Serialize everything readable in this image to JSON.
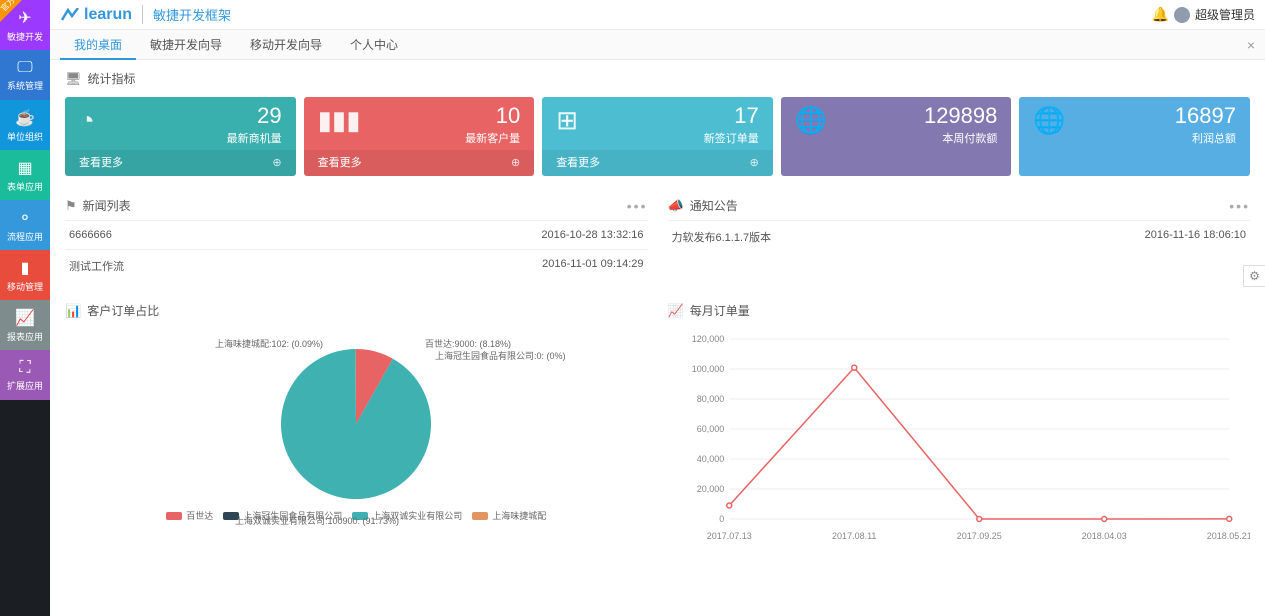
{
  "corner_tag": "官方",
  "logo": {
    "text": "learun",
    "sub": "敏捷开发框架"
  },
  "user": {
    "name": "超级管理员"
  },
  "sidebar": {
    "items": [
      {
        "label": "敏捷开发"
      },
      {
        "label": "系统管理"
      },
      {
        "label": "单位组织"
      },
      {
        "label": "表单应用"
      },
      {
        "label": "流程应用"
      },
      {
        "label": "移动管理"
      },
      {
        "label": "报表应用"
      },
      {
        "label": "扩展应用"
      }
    ]
  },
  "tabs": {
    "items": [
      {
        "label": "我的桌面"
      },
      {
        "label": "敏捷开发向导"
      },
      {
        "label": "移动开发向导"
      },
      {
        "label": "个人中心"
      }
    ]
  },
  "stats_title": "统计指标",
  "cards": [
    {
      "num": "29",
      "label": "最新商机量",
      "footer": "查看更多"
    },
    {
      "num": "10",
      "label": "最新客户量",
      "footer": "查看更多"
    },
    {
      "num": "17",
      "label": "新签订单量",
      "footer": "查看更多"
    },
    {
      "num": "129898",
      "label": "本周付款额",
      "footer": ""
    },
    {
      "num": "16897",
      "label": "利润总额",
      "footer": ""
    }
  ],
  "news": {
    "title": "新闻列表",
    "rows": [
      {
        "text": "6666666",
        "time": "2016-10-28 13:32:16"
      },
      {
        "text": "测试工作流",
        "time": "2016-11-01 09:14:29"
      }
    ]
  },
  "notices": {
    "title": "通知公告",
    "rows": [
      {
        "text": "力软发布6.1.1.7版本",
        "time": "2016-11-16 18:06:10"
      }
    ]
  },
  "pie_title": "客户订单占比",
  "line_title": "每月订单量",
  "chart_data": [
    {
      "type": "pie",
      "title": "客户订单占比",
      "series": [
        {
          "name": "百世达",
          "value": 9000,
          "pct": 8.18,
          "color": "#e86464"
        },
        {
          "name": "上海冠生园食品有限公司",
          "value": 0,
          "pct": 0,
          "color": "#2f4554"
        },
        {
          "name": "上海双诚实业有限公司",
          "value": 100900,
          "pct": 91.73,
          "color": "#3fb1b0"
        },
        {
          "name": "上海味捷城配",
          "value": 102,
          "pct": 0.09,
          "color": "#e19661"
        }
      ],
      "labels": {
        "top_left": "上海味捷城配:102: (0.09%)",
        "top_right1": "百世达:9000: (8.18%)",
        "top_right2": "上海冠生园食品有限公司:0: (0%)",
        "bottom": "上海双诚实业有限公司:100900: (91.73%)"
      }
    },
    {
      "type": "line",
      "title": "每月订单量",
      "xlabel": "",
      "ylabel": "",
      "ylim": [
        0,
        120000
      ],
      "categories": [
        "2017.07.13",
        "2017.08.11",
        "2017.09.25",
        "2018.04.03",
        "2018.05.21"
      ],
      "values": [
        9000,
        100900,
        0,
        0,
        102
      ],
      "color": "#e86464"
    }
  ]
}
